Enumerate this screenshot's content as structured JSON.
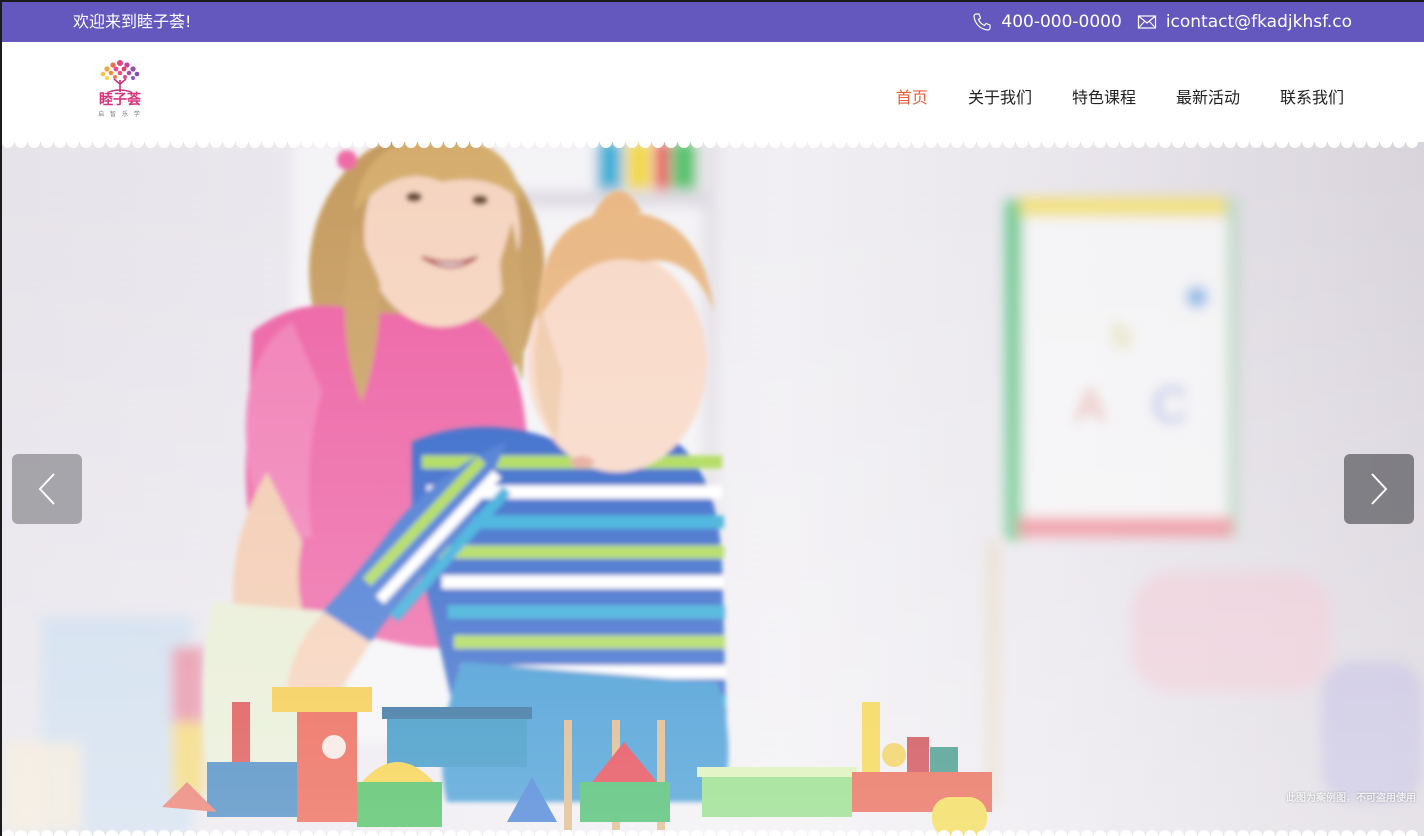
{
  "topbar": {
    "welcome": "欢迎来到睦子荟!",
    "phone": "400-000-0000",
    "email": "icontact@fkadjkhsf.co",
    "phone_icon": "phone-icon",
    "email_icon": "mail-icon"
  },
  "logo": {
    "name": "睦子荟",
    "sub": "启 智 乐 学"
  },
  "nav": {
    "items": [
      {
        "label": "首页",
        "active": true
      },
      {
        "label": "关于我们",
        "active": false
      },
      {
        "label": "特色课程",
        "active": false
      },
      {
        "label": "最新活动",
        "active": false
      },
      {
        "label": "联系我们",
        "active": false
      }
    ]
  },
  "hero": {
    "watermark": "此图为案例图，不可盗用使用",
    "prev_icon": "chevron-left-icon",
    "next_icon": "chevron-right-icon"
  },
  "colors": {
    "topbar": "#6457bd",
    "nav_active": "#e5613d",
    "logo_pink": "#d8347c"
  }
}
